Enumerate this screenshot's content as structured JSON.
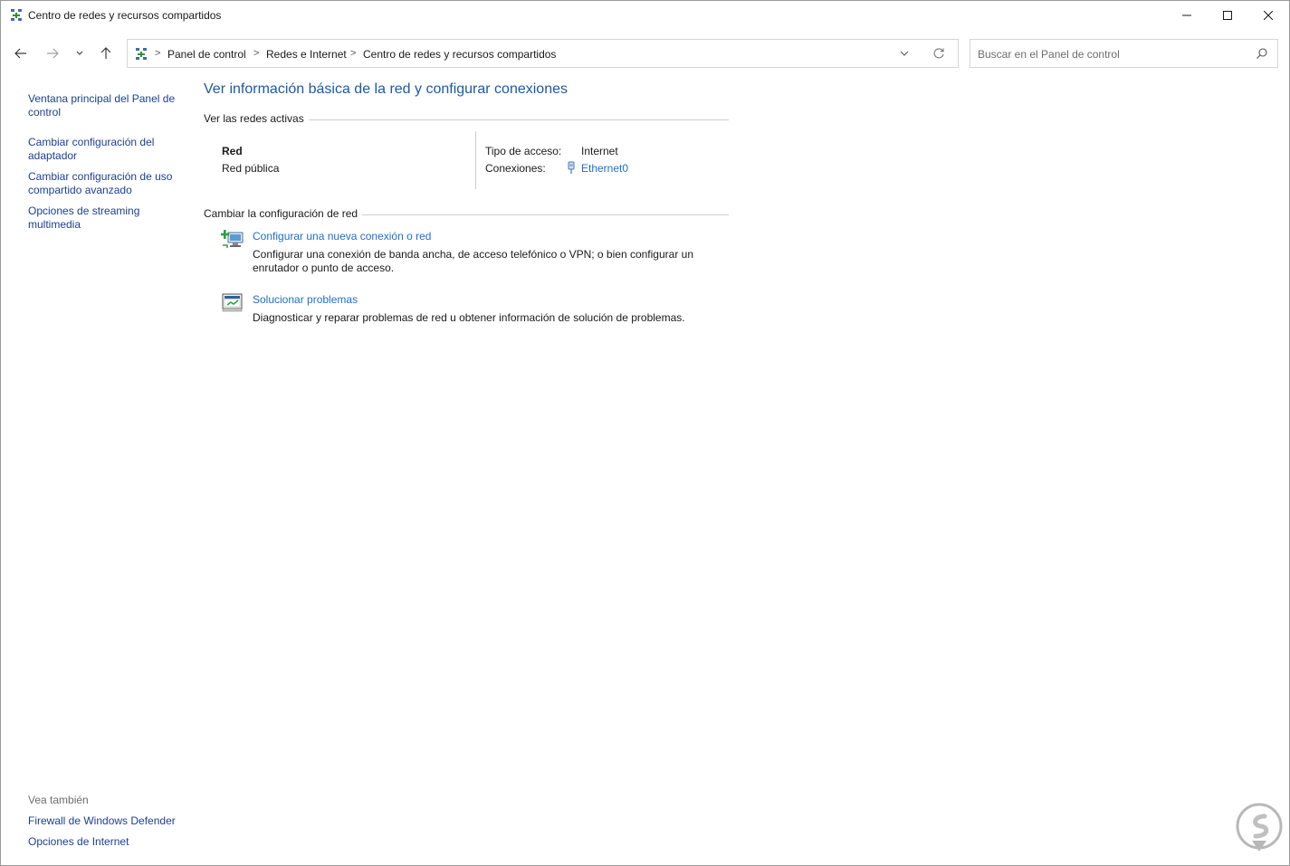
{
  "window": {
    "title": "Centro de redes y recursos compartidos"
  },
  "address": {
    "crumbs": [
      "Panel de control",
      "Redes e Internet",
      "Centro de redes y recursos compartidos"
    ],
    "separator": ">"
  },
  "search": {
    "placeholder": "Buscar en el Panel de control"
  },
  "sidebar": {
    "items": [
      {
        "label": "Ventana principal del Panel de control"
      },
      {
        "label": "Cambiar configuración del adaptador"
      },
      {
        "label": "Cambiar configuración de uso compartido avanzado"
      },
      {
        "label": "Opciones de streaming multimedia"
      }
    ],
    "see_also_heading": "Vea también",
    "see_also": [
      {
        "label": "Firewall de Windows Defender"
      },
      {
        "label": "Opciones de Internet"
      }
    ]
  },
  "main": {
    "title": "Ver información básica de la red y configurar conexiones",
    "active_networks_heading": "Ver las redes activas",
    "network": {
      "name": "Red",
      "category": "Red pública",
      "access_label": "Tipo de acceso:",
      "access_value": "Internet",
      "connections_label": "Conexiones:",
      "connection_name": "Ethernet0"
    },
    "change_heading": "Cambiar la configuración de red",
    "tasks": [
      {
        "link": "Configurar una nueva conexión o red",
        "description": "Configurar una conexión de banda ancha, de acceso telefónico o VPN; o bien configurar un enrutador o punto de acceso.",
        "icon": "new-connection-icon"
      },
      {
        "link": "Solucionar problemas",
        "description": "Diagnosticar y reparar problemas de red u obtener información de solución de problemas.",
        "icon": "troubleshoot-icon"
      }
    ]
  },
  "colors": {
    "link": "#1c3f91",
    "accent_link": "#1e6fc9",
    "title": "#1c5aa6"
  }
}
